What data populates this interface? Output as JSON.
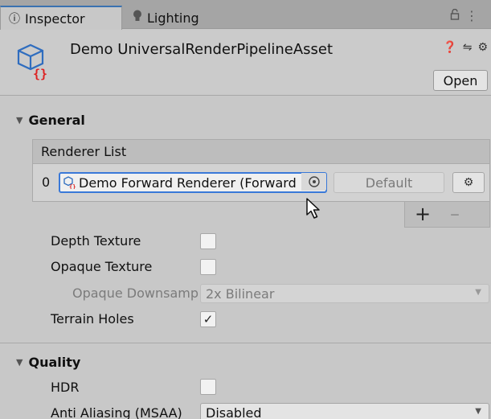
{
  "tabs": [
    {
      "label": "Inspector",
      "icon": "info-icon"
    },
    {
      "label": "Lighting",
      "icon": "lightbulb-icon"
    }
  ],
  "header": {
    "asset_name": "Demo UniversalRenderPipelineAsset",
    "open_label": "Open"
  },
  "sections": {
    "general": "General",
    "quality": "Quality"
  },
  "renderer_list": {
    "title": "Renderer List",
    "items": [
      {
        "index": "0",
        "value": "Demo Forward Renderer (Forward Renderer)",
        "default_label": "Default"
      }
    ],
    "add_label": "+",
    "remove_label": "–"
  },
  "general_props": {
    "depth_texture": {
      "label": "Depth Texture",
      "checked": false
    },
    "opaque_texture": {
      "label": "Opaque Texture",
      "checked": false
    },
    "opaque_downsampling": {
      "label": "Opaque Downsampling",
      "value": "2x Bilinear"
    },
    "terrain_holes": {
      "label": "Terrain Holes",
      "checked": true
    }
  },
  "quality_props": {
    "hdr": {
      "label": "HDR",
      "checked": false
    },
    "msaa": {
      "label": "Anti Aliasing (MSAA)",
      "value": "Disabled"
    }
  },
  "colors": {
    "accent": "#3a79d8",
    "panel": "#c8c8c8"
  }
}
